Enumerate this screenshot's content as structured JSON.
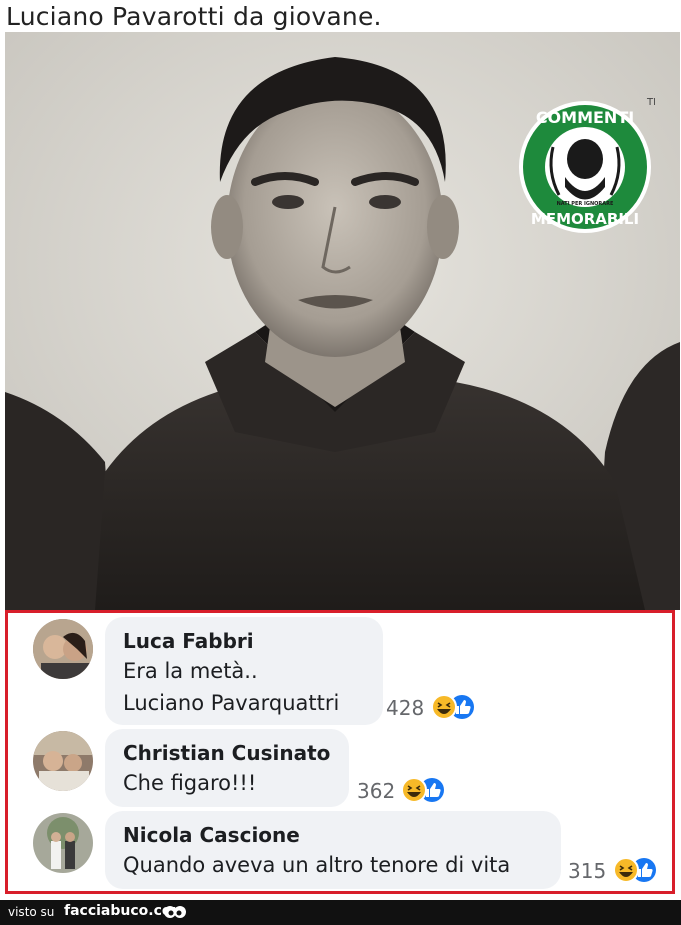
{
  "header": {
    "title": "Luciano Pavarotti da giovane."
  },
  "logo": {
    "top_text": "COMMENTI",
    "bottom_text": "MEMORABILI",
    "small_text": "NATI PER IGNORARE",
    "trademark": "TM"
  },
  "comments": [
    {
      "author": "Luca Fabbri",
      "lines": [
        "Era la metà..",
        "Luciano Pavarquattri"
      ],
      "reactions": "428"
    },
    {
      "author": "Christian Cusinato",
      "lines": [
        "Che figaro!!!"
      ],
      "reactions": "362"
    },
    {
      "author": "Nicola Cascione",
      "lines": [
        "Quando aveva un altro tenore di vita"
      ],
      "reactions": "315"
    }
  ],
  "footer": {
    "visto": "visto su",
    "site": "facciabuco.com"
  },
  "colors": {
    "frame": "#d81e2a",
    "bubble": "#f0f2f5",
    "logo_green": "#1e8a3c",
    "like_blue": "#1877f2",
    "haha_yellow": "#f7b928"
  },
  "icons": [
    "haha-emoji-icon",
    "like-thumb-icon",
    "eyes-icon"
  ]
}
